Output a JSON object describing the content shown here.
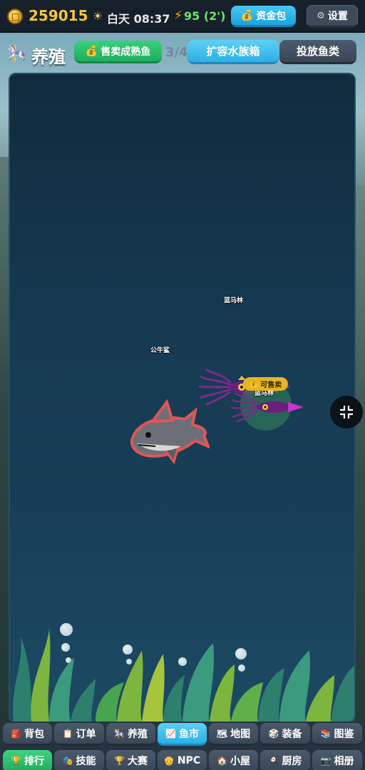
{
  "topbar": {
    "coins": "259015",
    "daytime": "白天 08:37",
    "energy": "95 (2')",
    "fund_label": "资金包",
    "settings_label": "设置"
  },
  "header": {
    "title": "养殖",
    "sell_all_label": "售卖成熟鱼",
    "capacity": "3/4",
    "expand_label": "扩容水族箱",
    "add_fish_label": "投放鱼类"
  },
  "tank": {
    "fish": [
      {
        "name": "蓝马林",
        "species": "squid"
      },
      {
        "name": "公牛鲨",
        "species": "shark"
      },
      {
        "name": "蓝马林",
        "species": "squid",
        "sellable": true
      }
    ],
    "sellable_label": "可售卖"
  },
  "nav": {
    "row1": [
      {
        "label": "背包",
        "icon": "backpack-icon"
      },
      {
        "label": "订单",
        "icon": "order-icon"
      },
      {
        "label": "养殖",
        "icon": "farming-icon"
      },
      {
        "label": "鱼市",
        "icon": "market-chart-icon",
        "active": true
      },
      {
        "label": "地图",
        "icon": "map-icon"
      },
      {
        "label": "装备",
        "icon": "equipment-icon"
      },
      {
        "label": "图鉴",
        "icon": "book-icon"
      }
    ],
    "row2": [
      {
        "label": "排行",
        "icon": "trophy-icon",
        "active": true
      },
      {
        "label": "技能",
        "icon": "skill-icon"
      },
      {
        "label": "大赛",
        "icon": "cup-icon"
      },
      {
        "label": "NPC",
        "icon": "npc-icon"
      },
      {
        "label": "小屋",
        "icon": "house-icon"
      },
      {
        "label": "厨房",
        "icon": "kitchen-icon"
      },
      {
        "label": "相册",
        "icon": "album-icon"
      }
    ]
  },
  "colors": {
    "coin": "#f5c542",
    "energy": "#6ee36e",
    "accent_blue": "#2bb0e6",
    "accent_green": "#1fae5e",
    "sellable": "#e6b521"
  }
}
